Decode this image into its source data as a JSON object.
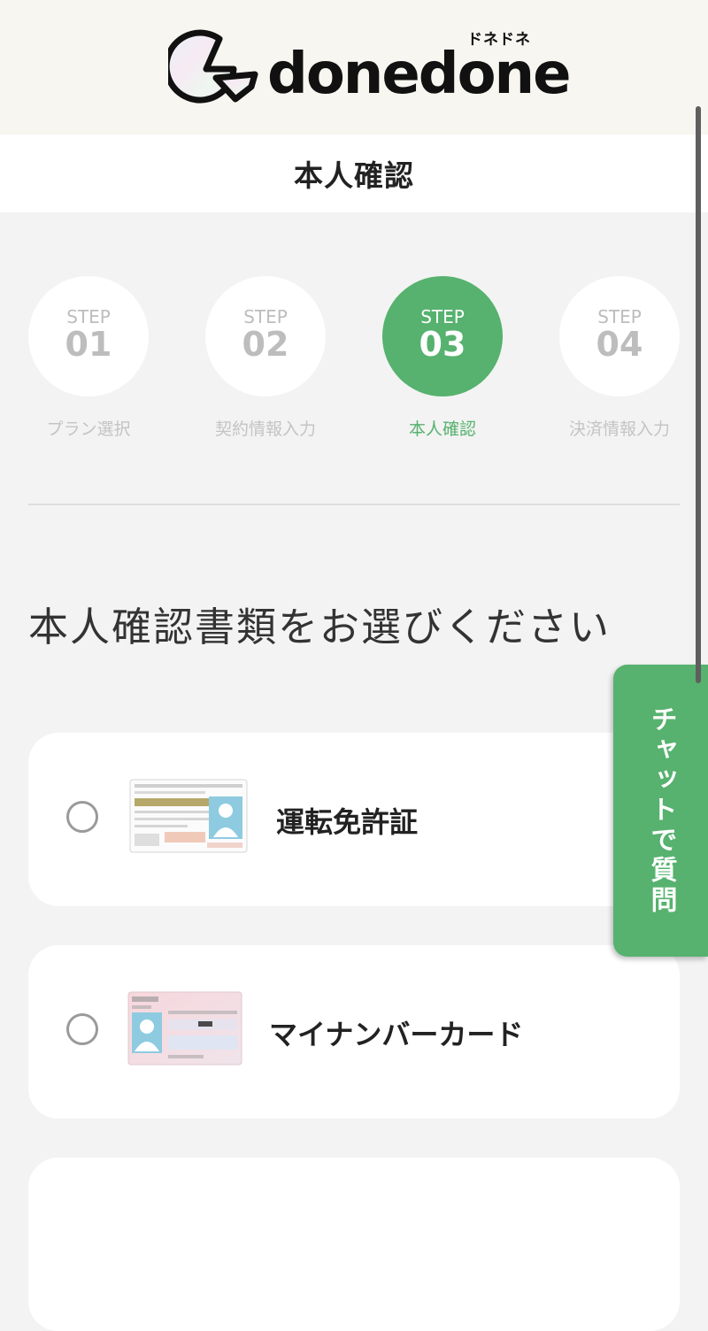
{
  "logo": {
    "wordmark": "donedone",
    "kana": "ドネドネ"
  },
  "page_title": "本人確認",
  "steps": [
    {
      "word": "STEP",
      "number": "01",
      "label": "プラン選択",
      "active": false
    },
    {
      "word": "STEP",
      "number": "02",
      "label": "契約情報入力",
      "active": false
    },
    {
      "word": "STEP",
      "number": "03",
      "label": "本人確認",
      "active": true
    },
    {
      "word": "STEP",
      "number": "04",
      "label": "決済情報入力",
      "active": false
    }
  ],
  "heading": "本人確認書類をお選びください",
  "options": [
    {
      "label": "運転免許証",
      "icon": "drivers-license-icon",
      "selected": false
    },
    {
      "label": "マイナンバーカード",
      "icon": "my-number-card-icon",
      "selected": false
    }
  ],
  "chat_button": "チャットで質問",
  "colors": {
    "accent": "#56b26e",
    "inactive": "#bdbdbd",
    "header_bg": "#f8f6f0"
  }
}
